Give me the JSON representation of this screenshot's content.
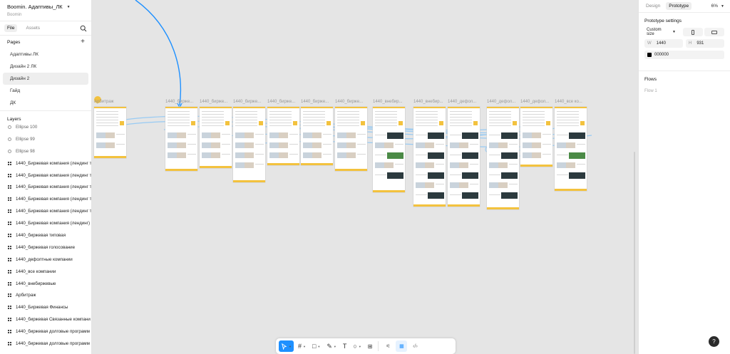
{
  "project": {
    "title": "Boomin. Адаптивы_ЛК",
    "team": "Boomin"
  },
  "file_tabs": {
    "file": "File",
    "assets": "Assets"
  },
  "pages": {
    "heading": "Pages",
    "items": [
      "Адаптивы ЛК",
      "Дизайн 2 ЛК",
      "Дизайн 2",
      "Гайд",
      "ДК"
    ],
    "selected": "Дизайн 2"
  },
  "layers": {
    "heading": "Layers",
    "items": [
      "Ellipse 100",
      "Ellipse 99",
      "Ellipse 98",
      "1440_Биржевая компания (лендинг т",
      "1440_Биржевая компания (лендинг т",
      "1440_Биржевая компания (лендинг т",
      "1440_Биржевая компания (лендинг т",
      "1440_Биржевая компания (лендинг т",
      "1440_Биржевая компания (лендинг)",
      "1440_биржевая типовая",
      "1440_биржевая голосование",
      "1440_дефолтные компании",
      "1440_все компании",
      "1440_внебиржевые",
      "Арбитраж",
      "1440_Биржевая Финансы",
      "1440_биржевая Связанные компани",
      "1440_биржевая долговые программ",
      "1440_биржевая долговые программ"
    ]
  },
  "right_panel": {
    "tabs": [
      "Design",
      "Prototype"
    ],
    "active_tab": "Prototype",
    "zoom": "6%",
    "prototype_settings": "Prototype settings",
    "device": "Custom size",
    "width_label": "W",
    "width": "1440",
    "height_label": "H",
    "height": "931",
    "bg_color": "000000",
    "flows_heading": "Flows",
    "flow": "Flow 1",
    "help": "?"
  },
  "canvas": {
    "frame_labels": [
      "Арбитраж",
      "1440_бирже...",
      "1440_бирже...",
      "1440_бирже...",
      "1440_бирже...",
      "1440_бирже...",
      "1440_бирже...",
      "1440_внебир...",
      "1440_внебир...",
      "1440_дефол...",
      "1440_дефол...",
      "1440_дефол...",
      "1440_все ко..."
    ]
  },
  "colors": {
    "accent": "#1e90ff",
    "frame_accent": "#f3c23e",
    "canvas": "#e5e5e5",
    "connector": "#8fc8f5"
  }
}
